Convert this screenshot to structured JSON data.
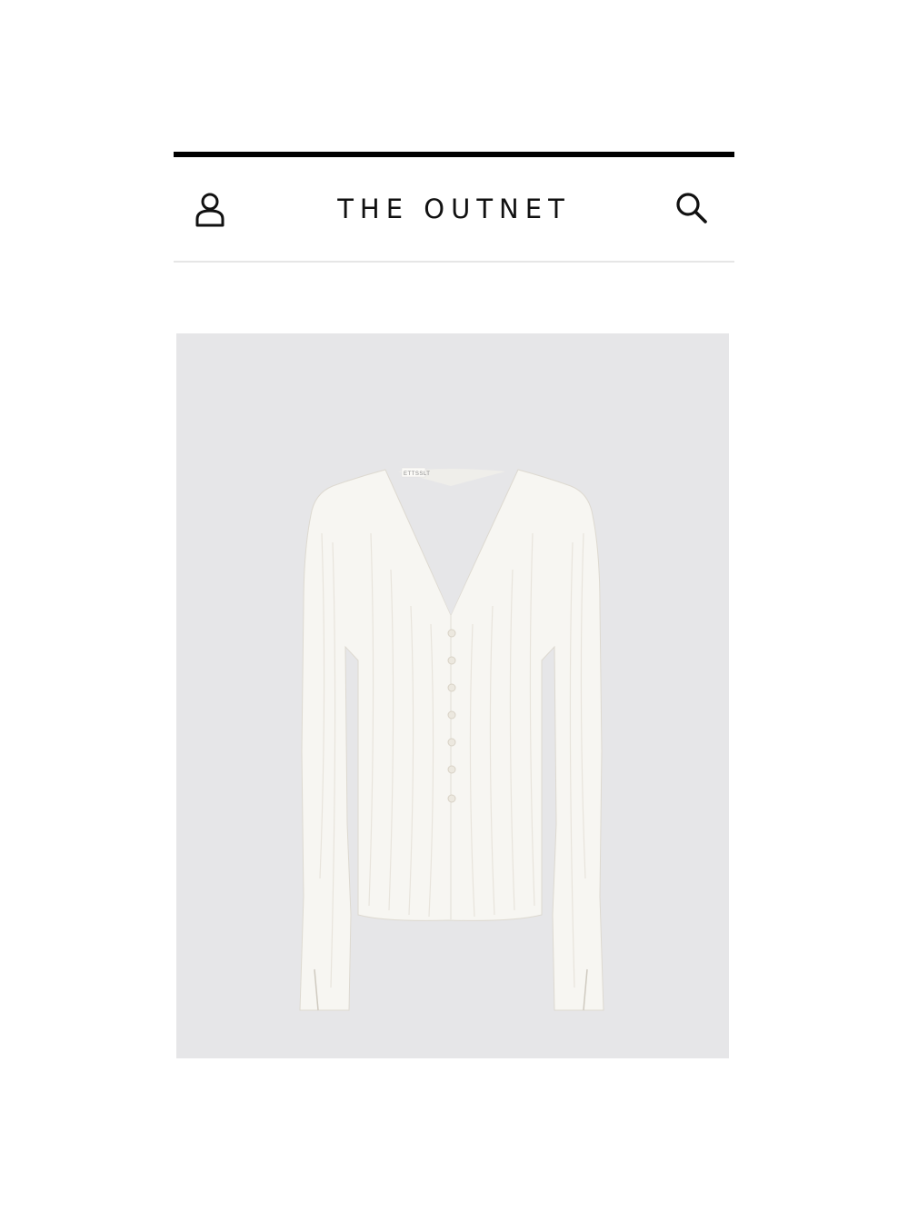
{
  "header": {
    "brand": "THE OUTNET",
    "account_icon": "account-icon",
    "search_icon": "search-icon"
  },
  "product": {
    "image_alt": "White crinkled knit V-neck cardigan",
    "label_text": "ETTSSLT",
    "background_color": "#e6e6e8",
    "garment_color": "#f7f6f2"
  },
  "colors": {
    "rule": "#000000",
    "divider": "#e6e6e6"
  }
}
